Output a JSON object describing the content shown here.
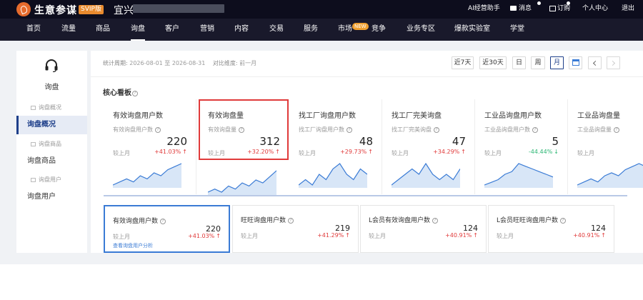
{
  "topbar": {
    "brand": "生意参谋",
    "badge": "SVIP版",
    "shop_name": "宜兴",
    "ai_assistant": "AI经营助手",
    "messages": "消息",
    "subscribe": "订购",
    "user_center": "个人中心",
    "logout": "退出"
  },
  "nav": {
    "items": [
      "首页",
      "流量",
      "商品",
      "询盘",
      "客户",
      "营销",
      "内容",
      "交易",
      "服务",
      "市场",
      "竞争",
      "业务专区",
      "爆款实验室",
      "学堂"
    ],
    "active_index": 3,
    "new_badge": "NEW"
  },
  "sidebar": {
    "title": "询盘",
    "sub1": "询盘概况",
    "item1": "询盘概况",
    "sub2": "询盘商品",
    "item2": "询盘商品",
    "sub3": "询盘用户",
    "item3": "询盘用户"
  },
  "filters": {
    "period_label": "统计周期:",
    "period_start": "2026-08-01",
    "period_to": "至",
    "period_end": "2026-08-31",
    "compare_label": "对比维度:",
    "compare_value": "前一月"
  },
  "controls": {
    "last7": "近7天",
    "last30": "近30天",
    "day": "日",
    "week": "周",
    "month": "月"
  },
  "section_title": "核心看板",
  "cards": [
    {
      "title": "有效询盘用户数",
      "sub": "有效询盘用户数",
      "value": "220",
      "compare": "较上月",
      "pct": "+41.03%",
      "dir": "up",
      "spark": [
        3,
        4,
        5,
        4,
        6,
        5,
        7,
        6,
        8,
        9,
        10
      ]
    },
    {
      "title": "有效询盘量",
      "sub": "有效询盘量",
      "value": "312",
      "compare": "较上月",
      "pct": "+32.20%",
      "dir": "up",
      "spark": [
        3,
        4,
        3,
        5,
        4,
        6,
        5,
        7,
        6,
        8,
        10
      ]
    },
    {
      "title": "找工厂询盘用户数",
      "sub": "找工厂询盘用户数",
      "value": "48",
      "compare": "较上月",
      "pct": "+29.73%",
      "dir": "up",
      "spark": [
        4,
        5,
        4,
        6,
        5,
        7,
        8,
        6,
        5,
        7,
        6
      ]
    },
    {
      "title": "找工厂完美询盘",
      "sub": "找工厂完美询盘",
      "value": "47",
      "compare": "较上月",
      "pct": "+34.29%",
      "dir": "up",
      "spark": [
        5,
        6,
        7,
        8,
        7,
        9,
        7,
        6,
        7,
        6,
        8
      ]
    },
    {
      "title": "工业品询盘用户数",
      "sub": "工业品询盘用户数",
      "value": "5",
      "compare": "较上月",
      "pct": "-44.44%",
      "dir": "down",
      "spark": [
        1,
        2,
        3,
        5,
        6,
        9,
        8,
        7,
        6,
        5,
        4
      ]
    },
    {
      "title": "工业品询盘量",
      "sub": "工业品询盘量",
      "value": "",
      "compare": "较上月",
      "pct": "",
      "dir": "up",
      "spark": [
        2,
        3,
        4,
        3,
        5,
        6,
        5,
        7,
        8,
        9,
        8
      ]
    }
  ],
  "bottom_cards": [
    {
      "title": "有效询盘用户数",
      "value": "220",
      "compare": "较上月",
      "pct": "+41.03%",
      "link": "查看询盘用户分析"
    },
    {
      "title": "旺旺询盘用户数",
      "value": "219",
      "compare": "较上月",
      "pct": "+41.29%"
    },
    {
      "title": "L会员有效询盘用户数",
      "value": "124",
      "compare": "较上月",
      "pct": "+40.91%"
    },
    {
      "title": "L会员旺旺询盘用户数",
      "value": "124",
      "compare": "较上月",
      "pct": "+40.91%"
    }
  ],
  "colors": {
    "spark_line": "#3a7bd5",
    "spark_fill": "#d8e6f7",
    "up": "#e03a3a",
    "down": "#2bb673",
    "highlight": "#e03a3a"
  }
}
